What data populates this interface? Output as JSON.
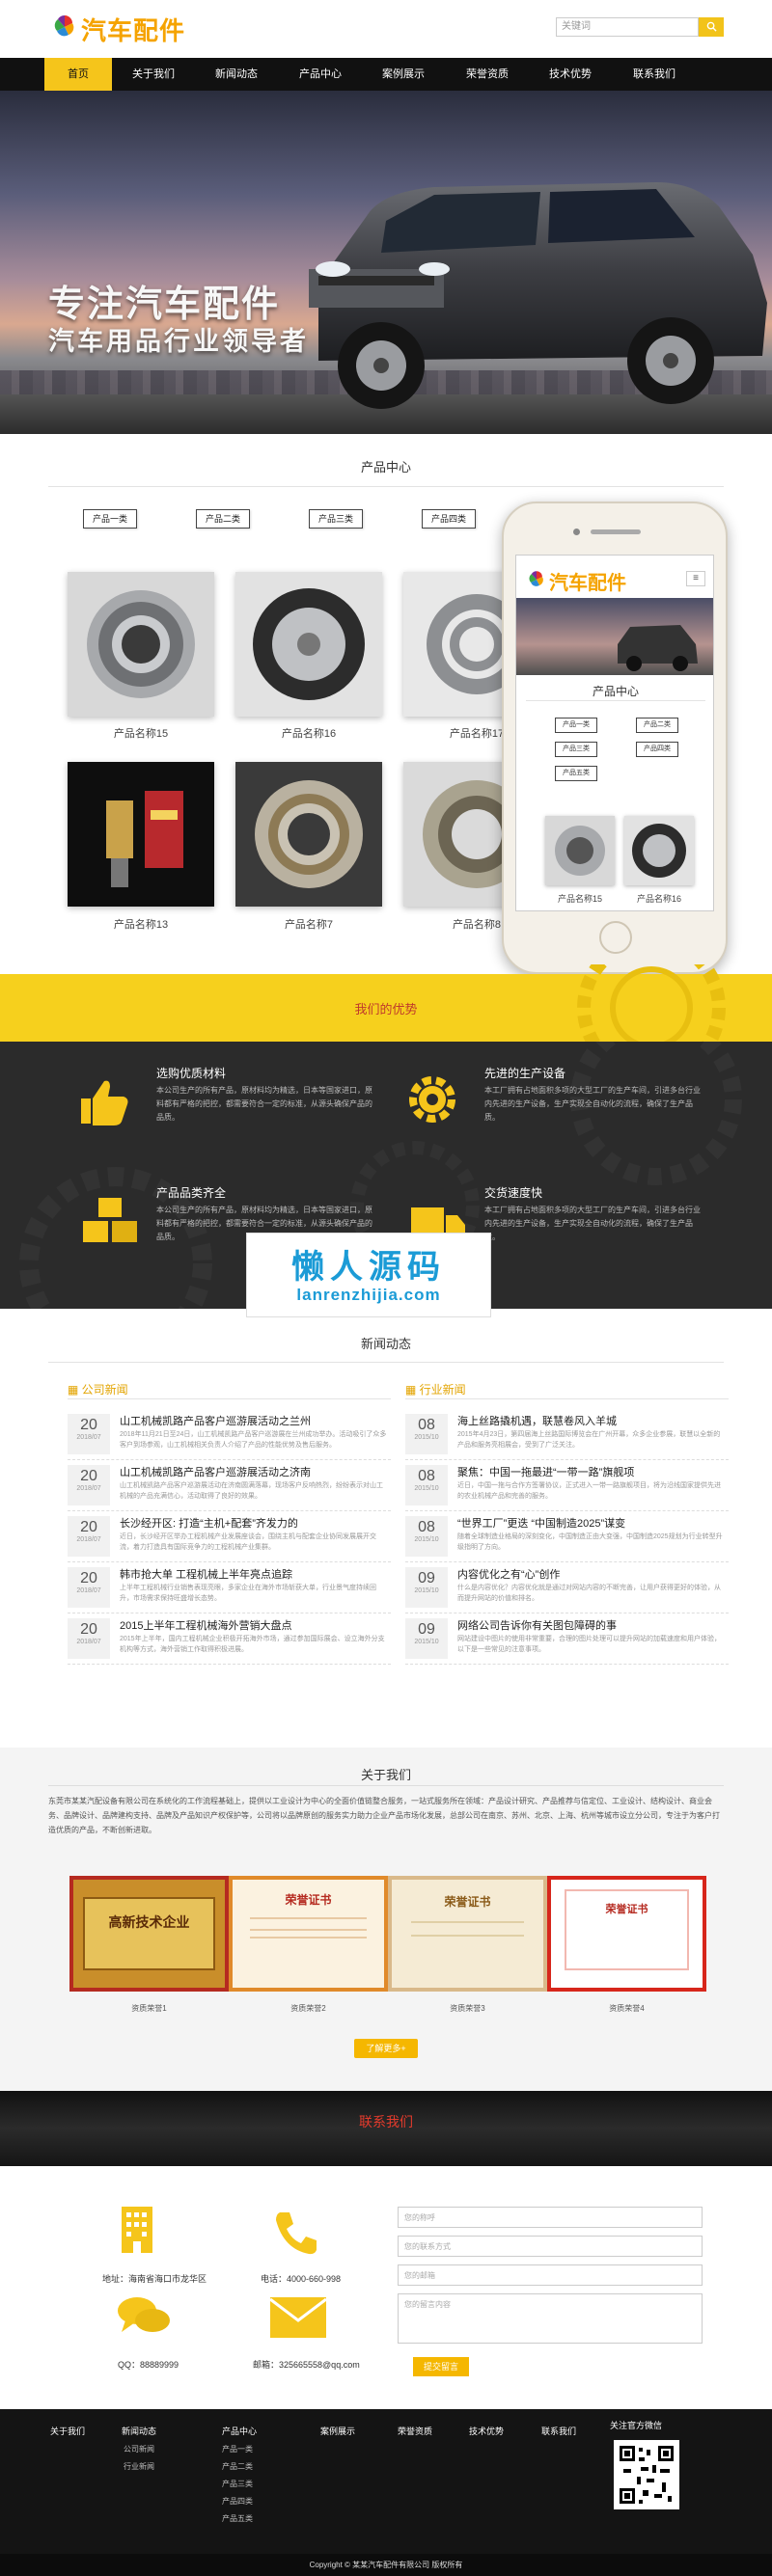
{
  "header": {
    "logo_text": "汽车配件",
    "search_placeholder": "关键词",
    "search_button": "搜"
  },
  "nav": {
    "items": [
      "首页",
      "关于我们",
      "新闻动态",
      "产品中心",
      "案例展示",
      "荣誉资质",
      "技术优势",
      "联系我们"
    ],
    "active_index": 0
  },
  "banner": {
    "slogan_line1": "专注汽车配件",
    "slogan_line2": "汽车用品行业领导者",
    "slide_count": 3,
    "active_slide": 0
  },
  "products": {
    "title": "产品中心",
    "tabs": [
      "产品一类",
      "产品二类",
      "产品三类",
      "产品四类"
    ],
    "items": [
      {
        "name": "产品名称15",
        "icon": "bearing-image"
      },
      {
        "name": "产品名称16",
        "icon": "tire-image"
      },
      {
        "name": "产品名称17",
        "icon": "ball-bearing-image"
      },
      {
        "name": "产品名称13",
        "icon": "led-bulb-image"
      },
      {
        "name": "产品名称7",
        "icon": "roller-bearing-image"
      },
      {
        "name": "产品名称8",
        "icon": "bearing-image"
      }
    ]
  },
  "phone": {
    "logo_text": "汽车配件",
    "menu_icon": "menu-icon",
    "title": "产品中心",
    "tabs": [
      "产品一类",
      "产品二类",
      "产品三类",
      "产品四类",
      "产品五类"
    ],
    "items": [
      "产品名称15",
      "产品名称16"
    ]
  },
  "advantages": {
    "title": "我们的优势",
    "items": [
      {
        "title": "选购优质材料",
        "text": "本公司生产的所有产品，原材料均为精选，日本等国家进口，原料都有严格的把控，都需要符合一定的标准，从源头确保产品的品质。",
        "icon": "thumbs-up-icon"
      },
      {
        "title": "先进的生产设备",
        "text": "本工厂拥有占地面积多项的大型工厂的生产车间，引进多台行业内先进的生产设备，生产实现全自动化的流程，确保了生产品质。",
        "icon": "gear-icon"
      },
      {
        "title": "产品品类齐全",
        "text": "本公司生产的所有产品，原材料均为精选，日本等国家进口，原料都有严格的把控，都需要符合一定的标准，从源头确保产品的品质。",
        "icon": "cubes-icon"
      },
      {
        "title": "交货速度快",
        "text": "本工厂拥有占地面积多项的大型工厂的生产车间，引进多台行业内先进的生产设备，生产实现全自动化的流程，确保了生产品质。",
        "icon": "truck-icon"
      }
    ]
  },
  "watermark": {
    "line1": "懒人源码",
    "line2": "lanrenzhijia.com"
  },
  "news": {
    "title": "新闻动态",
    "left_head": "公司新闻",
    "right_head": "行业新闻",
    "left": [
      {
        "day": "20",
        "ym": "2018/07",
        "title": "山工机械凯路产品客户巡游展活动之兰州",
        "summary": "2018年11月21日至24日，山工机械凯路产品客户巡游展在兰州成功举办。活动吸引了众多客户到场参观，山工机械相关负责人介绍了产品的性能优势及售后服务。"
      },
      {
        "day": "20",
        "ym": "2018/07",
        "title": "山工机械凯路产品客户巡游展活动之济南",
        "summary": "山工机械凯路产品客户巡游展活动在济南圆满落幕，现场客户反响热烈，纷纷表示对山工机械的产品充满信心，活动取得了良好的效果。"
      },
      {
        "day": "20",
        "ym": "2018/07",
        "title": "长沙经开区: 打造“主机+配套”齐发力的",
        "summary": "近日，长沙经开区举办工程机械产业发展座谈会，围绕主机与配套企业协同发展展开交流，着力打造具有国际竞争力的工程机械产业集群。"
      },
      {
        "day": "20",
        "ym": "2018/07",
        "title": "韩市抢大单 工程机械上半年亮点追踪",
        "summary": "上半年工程机械行业销售表现亮眼，多家企业在海外市场斩获大单，行业景气度持续回升，市场需求保持旺盛增长态势。"
      },
      {
        "day": "20",
        "ym": "2018/07",
        "title": "2015上半年工程机械海外营销大盘点",
        "summary": "2015年上半年，国内工程机械企业积极开拓海外市场，通过参加国际展会、设立海外分支机构等方式，海外营销工作取得积极进展。"
      }
    ],
    "right": [
      {
        "day": "08",
        "ym": "2015/10",
        "title": "海上丝路撬机遇，联慧卷风入羊城",
        "summary": "2015年4月23日，第四届海上丝路国际博览会在广州开幕，众多企业参展，联慧以全新的产品和服务亮相展会，受到了广泛关注。"
      },
      {
        "day": "08",
        "ym": "2015/10",
        "title": "聚焦：中国一拖最进“一带一路”旗舰项",
        "summary": "近日，中国一拖与合作方签署协议，正式进入一带一路旗舰项目，将为沿线国家提供先进的农业机械产品和完善的服务。"
      },
      {
        "day": "08",
        "ym": "2015/10",
        "title": "“世界工厂”更迭 “中国制造2025”谋变",
        "summary": "随着全球制造业格局的深刻变化，中国制造正由大变强，中国制造2025规划为行业转型升级指明了方向。"
      },
      {
        "day": "09",
        "ym": "2015/10",
        "title": "内容优化之有“心”创作",
        "summary": "什么是内容优化？内容优化就是通过对网站内容的不断完善，让用户获得更好的体验，从而提升网站的价值和排名。"
      },
      {
        "day": "09",
        "ym": "2015/10",
        "title": "网络公司告诉你有关图包障碍的事",
        "summary": "网站建设中图片的使用非常重要，合理的图片处理可以提升网站的加载速度和用户体验，以下是一些常见的注意事项。"
      }
    ]
  },
  "about": {
    "title": "关于我们",
    "text": "东莞市某某汽配设备有限公司在系统化的工作流程基础上，提供以工业设计为中心的全面价值链整合服务，一站式服务所在领域：产品设计研究、产品推荐与信定位、工业设计、结构设计、商业会务、品牌设计、品牌建构支持、品牌及产品知识产权保护等，公司将以品牌原创的服务实力助力企业产品市场化发展，总部公司在南京、苏州、北京、上海、杭州等城市设立分公司，专注于为客户打造优质的产品，不断创新进取。",
    "certs": [
      "资质荣誉1",
      "资质荣誉2",
      "资质荣誉3",
      "资质荣誉4"
    ],
    "cert_texts": [
      "高新技术企业",
      "荣誉证书",
      "荣誉证书",
      "荣誉证书"
    ],
    "more_button": "了解更多+"
  },
  "contact": {
    "title": "联系我们",
    "address_label": "地址：海南省海口市龙华区",
    "phone_label": "电话：4000-660-998",
    "qq_label": "QQ：88889999",
    "email_label": "邮箱：325665558@qq.com",
    "fields": [
      "您的称呼",
      "您的联系方式",
      "您的邮箱",
      "您的留言内容"
    ],
    "submit": "提交留言"
  },
  "footer": {
    "columns": [
      {
        "head": "关于我们",
        "items": []
      },
      {
        "head": "新闻动态",
        "items": [
          "公司新闻",
          "行业新闻"
        ]
      },
      {
        "head": "产品中心",
        "items": [
          "产品一类",
          "产品二类",
          "产品三类",
          "产品四类",
          "产品五类"
        ]
      },
      {
        "head": "案例展示",
        "items": []
      },
      {
        "head": "荣誉资质",
        "items": []
      },
      {
        "head": "技术优势",
        "items": []
      },
      {
        "head": "联系我们",
        "items": []
      }
    ],
    "qr_title": "关注官方微信",
    "copyright": "Copyright © 某某汽车配件有限公司 版权所有"
  }
}
